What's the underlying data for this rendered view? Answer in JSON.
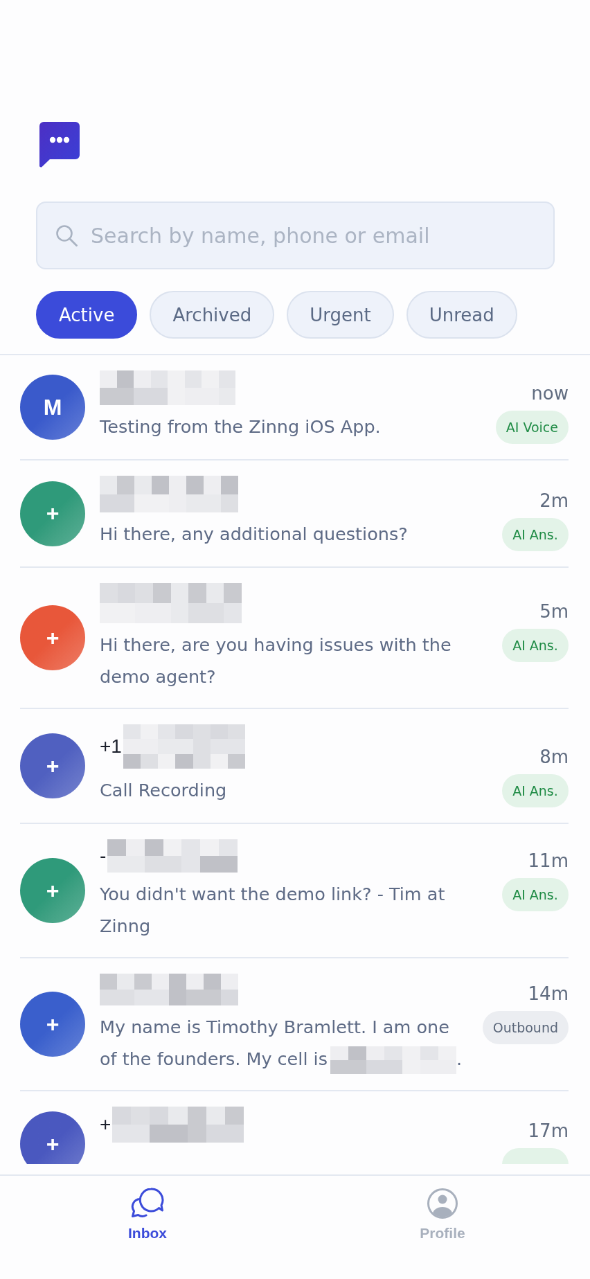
{
  "search": {
    "placeholder": "Search by name, phone or email"
  },
  "filters": [
    {
      "label": "Active",
      "selected": true
    },
    {
      "label": "Archived",
      "selected": false
    },
    {
      "label": "Urgent",
      "selected": false
    },
    {
      "label": "Unread",
      "selected": false
    }
  ],
  "conversations": [
    {
      "avatar": {
        "label": "M",
        "color": "#3a5acb"
      },
      "name_redacted": true,
      "time": "now",
      "message": "Testing from the Zinng iOS App.",
      "badge": {
        "label": "AI Voice",
        "kind": "ai"
      }
    },
    {
      "avatar": {
        "label": "+",
        "color": "#2f9a7a"
      },
      "name_redacted": true,
      "time": "2m",
      "message": "Hi there, any additional questions?",
      "badge": {
        "label": "AI Ans.",
        "kind": "ai"
      }
    },
    {
      "avatar": {
        "label": "+",
        "color": "#e8573a"
      },
      "name_redacted": true,
      "time": "5m",
      "message": "Hi there, are you having issues with the demo agent?",
      "badge": {
        "label": "AI Ans.",
        "kind": "ai"
      }
    },
    {
      "avatar": {
        "label": "+",
        "color": "#5060c0"
      },
      "name_prefix": "+1",
      "name_redacted": true,
      "time": "8m",
      "message": "Call Recording",
      "badge": {
        "label": "AI Ans.",
        "kind": "ai"
      }
    },
    {
      "avatar": {
        "label": "+",
        "color": "#2f9a7a"
      },
      "name_prefix": "-",
      "name_redacted": true,
      "time": "11m",
      "message": "You didn't want the demo link? - Tim at Zinng",
      "badge": {
        "label": "AI Ans.",
        "kind": "ai"
      }
    },
    {
      "avatar": {
        "label": "+",
        "color": "#3a5fcc"
      },
      "name_redacted": true,
      "time": "14m",
      "message": "My name is Timothy Bramlett. I am one of the founders. My cell is",
      "message_redacted": true,
      "message_end": ".",
      "badge": {
        "label": "Outbound",
        "kind": "outbound"
      }
    },
    {
      "avatar": {
        "label": "+",
        "color": "#4a58bf"
      },
      "name_prefix": "+",
      "name_redacted": true,
      "time": "17m",
      "badge": {
        "kind": "ai"
      }
    }
  ],
  "tabs": [
    {
      "label": "Inbox",
      "kind": "inbox",
      "selected": true
    },
    {
      "label": "Profile",
      "kind": "profile",
      "selected": false
    }
  ]
}
